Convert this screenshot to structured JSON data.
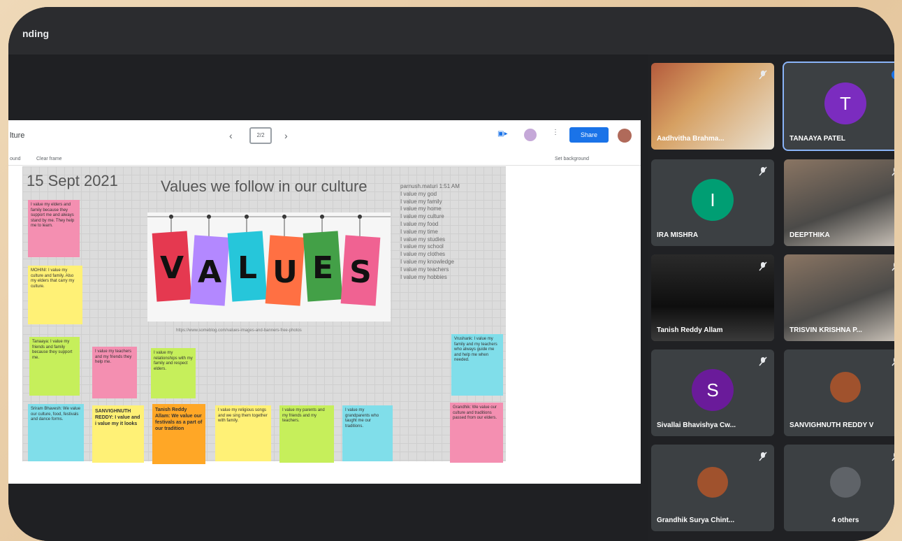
{
  "meeting": {
    "presenting_label": "nding"
  },
  "jamboard": {
    "file_name": "lture",
    "menu_left": "ound",
    "menu_clear": "Clear frame",
    "frame_label": "2/2",
    "share_label": "Share",
    "set_background": "Set background",
    "date": "15 Sept 2021",
    "heading": "Values we follow in our culture",
    "image_caption": "https://www.someblog.com/values-images-and-banners-free-photos",
    "values_word": [
      "V",
      "A",
      "L",
      "U",
      "E",
      "S"
    ],
    "values_list": [
      "parnush.maturi 1:51 AM",
      "I value my god",
      "I value my family",
      "I value my home",
      "I value my culture",
      "I value my food",
      "I value my time",
      "I value my studies",
      "I value my school",
      "I value my clothes",
      "I value my knowledge",
      "I value my teachers",
      "I value my hobbies"
    ],
    "sticky_notes": [
      {
        "text": "I value my elders and family because they support me and always stand by me. They help me to learn.",
        "color": "#f48fb1",
        "big": false
      },
      {
        "text": "MOHINI: I value my culture and family. Also my elders that carry my culture.",
        "color": "#fff176",
        "big": false
      },
      {
        "text": "Tanaaya: I value my friends and family because they support me.",
        "color": "#c6ef5b",
        "big": false
      },
      {
        "text": "I value my teachers and my friends they help me.",
        "color": "#f48fb1",
        "big": false
      },
      {
        "text": "I value my relationships with my family and respect elders.",
        "color": "#c6ef5b",
        "big": false
      },
      {
        "text": "Vrushank: I value my family and my teachers who always guide me and help me when needed.",
        "color": "#80deea",
        "big": false
      },
      {
        "text": "Sriram Bhavesh: We value our culture, food, festivals and dance forms.",
        "color": "#80deea",
        "big": false
      },
      {
        "text": "SANVIGHNUTH REDDY: I value and i value my it looks",
        "color": "#fff176",
        "big": true
      },
      {
        "text": "Tanish Reddy Allam: We value our festivals as a part of our tradition",
        "color": "#ffa726",
        "big": true
      },
      {
        "text": "I value my religious songs and we sing them together with family.",
        "color": "#fff176",
        "big": false
      },
      {
        "text": "I value my parents and my friends and my teachers.",
        "color": "#c6ef5b",
        "big": false
      },
      {
        "text": "I value my grandparents who taught me our traditions.",
        "color": "#80deea",
        "big": false
      },
      {
        "text": "Grandhik: We value our culture and traditions passed from our elders.",
        "color": "#f48fb1",
        "big": false
      }
    ]
  },
  "participants": [
    {
      "name": "Aadhvitha Brahma...",
      "type": "video"
    },
    {
      "name": "TANAAYA PATEL",
      "initial": "T",
      "avatar_color": "#7b2cbf",
      "type": "avatar",
      "speaking": true
    },
    {
      "name": "IRA MISHRA",
      "initial": "I",
      "avatar_color": "#009e73",
      "type": "avatar"
    },
    {
      "name": "DEEPTHIKA",
      "type": "video"
    },
    {
      "name": "Tanish Reddy Allam",
      "type": "video"
    },
    {
      "name": "TRISVIN KRISHNA P...",
      "type": "video"
    },
    {
      "name": "Sivallai Bhavishya Cw...",
      "initial": "S",
      "avatar_color": "#6a1b9a",
      "type": "avatar"
    },
    {
      "name": "SANVIGHNUTH REDDY V",
      "type": "photo"
    },
    {
      "name": "Grandhik Surya Chint...",
      "type": "photo"
    },
    {
      "name": "4 others",
      "type": "group"
    }
  ]
}
